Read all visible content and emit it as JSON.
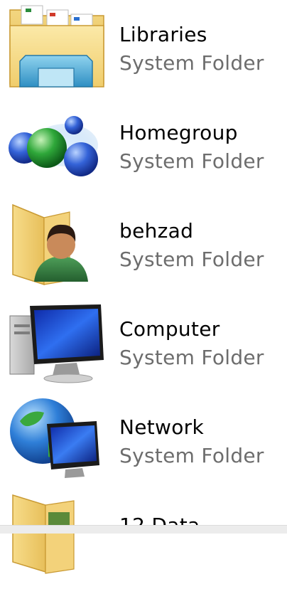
{
  "items": [
    {
      "name": "Libraries",
      "type": "System Folder",
      "icon": "libraries-icon"
    },
    {
      "name": "Homegroup",
      "type": "System Folder",
      "icon": "homegroup-icon"
    },
    {
      "name": "behzad",
      "type": "System Folder",
      "icon": "user-folder-icon"
    },
    {
      "name": "Computer",
      "type": "System Folder",
      "icon": "computer-icon"
    },
    {
      "name": "Network",
      "type": "System Folder",
      "icon": "network-icon"
    },
    {
      "name": "12 Data",
      "type": "",
      "icon": "folder-icon"
    }
  ],
  "colors": {
    "name_text": "#000000",
    "type_text": "#6d6d6d",
    "background": "#ffffff"
  }
}
